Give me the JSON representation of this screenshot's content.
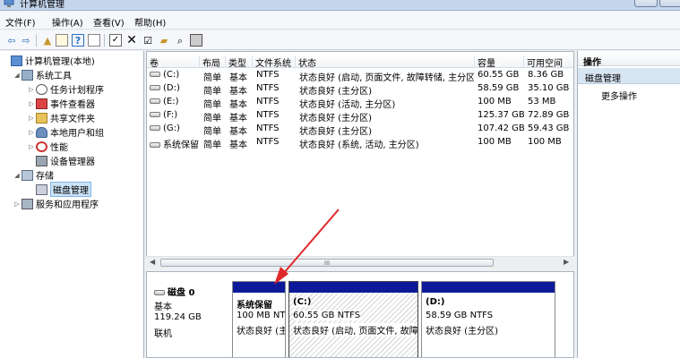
{
  "window": {
    "title": "计算机管理"
  },
  "menu": {
    "file": "文件(F)",
    "action": "操作(A)",
    "view": "查看(V)",
    "help": "帮助(H)"
  },
  "tree": {
    "root": "计算机管理(本地)",
    "system_tools": "系统工具",
    "task_scheduler": "任务计划程序",
    "event_viewer": "事件查看器",
    "shared_folders": "共享文件夹",
    "local_users": "本地用户和组",
    "performance": "性能",
    "device_manager": "设备管理器",
    "storage": "存储",
    "disk_management": "磁盘管理",
    "services_apps": "服务和应用程序"
  },
  "table": {
    "headers": {
      "vol": "卷",
      "layout": "布局",
      "type": "类型",
      "fs": "文件系统",
      "status": "状态",
      "capacity": "容量",
      "free": "可用空间"
    },
    "rows": [
      {
        "vol": "(C:)",
        "layout": "简单",
        "type": "基本",
        "fs": "NTFS",
        "status": "状态良好 (启动, 页面文件, 故障转储, 主分区)",
        "capacity": "60.55 GB",
        "free": "8.36 GB"
      },
      {
        "vol": "(D:)",
        "layout": "简单",
        "type": "基本",
        "fs": "NTFS",
        "status": "状态良好 (主分区)",
        "capacity": "58.59 GB",
        "free": "35.10 GB"
      },
      {
        "vol": "(E:)",
        "layout": "简单",
        "type": "基本",
        "fs": "NTFS",
        "status": "状态良好 (活动, 主分区)",
        "capacity": "100 MB",
        "free": "53 MB"
      },
      {
        "vol": "(F:)",
        "layout": "简单",
        "type": "基本",
        "fs": "NTFS",
        "status": "状态良好 (主分区)",
        "capacity": "125.37 GB",
        "free": "72.89 GB"
      },
      {
        "vol": "(G:)",
        "layout": "简单",
        "type": "基本",
        "fs": "NTFS",
        "status": "状态良好 (主分区)",
        "capacity": "107.42 GB",
        "free": "59.43 GB"
      },
      {
        "vol": "系统保留",
        "layout": "简单",
        "type": "基本",
        "fs": "NTFS",
        "status": "状态良好 (系统, 活动, 主分区)",
        "capacity": "100 MB",
        "free": "100 MB"
      }
    ],
    "scroll_mark": "III"
  },
  "actions": {
    "header": "操作",
    "section": "磁盘管理",
    "more": "更多操作"
  },
  "disk": {
    "name": "磁盘 0",
    "type": "基本",
    "size": "119.24 GB",
    "status": "联机",
    "partitions": [
      {
        "label": "系统保留",
        "size": "100 MB NT",
        "status": "状态良好 (主"
      },
      {
        "label": "(C:)",
        "size": "60.55 GB NTFS",
        "status": "状态良好 (启动, 页面文件, 故障转"
      },
      {
        "label": "(D:)",
        "size": "58.59 GB NTFS",
        "status": "状态良好 (主分区)"
      }
    ]
  },
  "colors": {
    "partition_bar": "#0c1a9a",
    "annotation_arrow": "#e0282b",
    "selection": "#cce4f7"
  }
}
